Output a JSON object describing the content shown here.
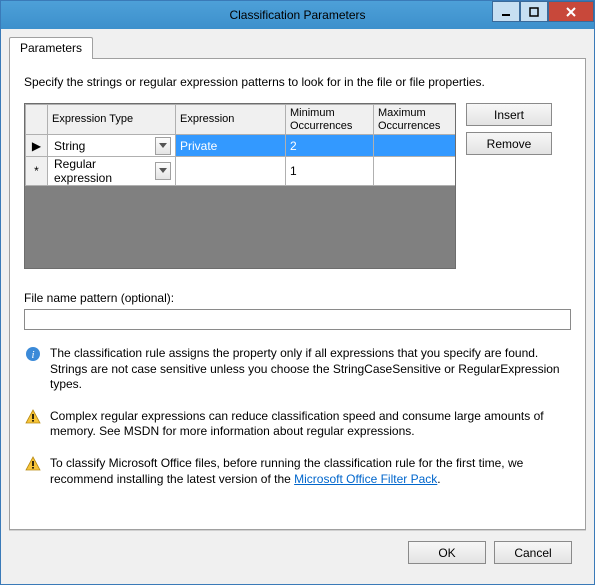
{
  "window": {
    "title": "Classification Parameters"
  },
  "tabs": {
    "parameters": "Parameters"
  },
  "instruction": "Specify the strings or regular expression patterns to look for in the file or file properties.",
  "grid": {
    "headers": {
      "expression_type": "Expression Type",
      "expression": "Expression",
      "min_occ": "Minimum Occurrences",
      "max_occ": "Maximum Occurrences"
    },
    "rows": [
      {
        "marker": "▶",
        "type": "String",
        "expression": "Private",
        "min": "2",
        "max": "",
        "selected": true
      },
      {
        "marker": "*",
        "type": "Regular expression",
        "expression": "",
        "min": "1",
        "max": "",
        "selected": false
      }
    ]
  },
  "buttons": {
    "insert": "Insert",
    "remove": "Remove",
    "ok": "OK",
    "cancel": "Cancel"
  },
  "filename_pattern": {
    "label": "File name pattern (optional):",
    "value": ""
  },
  "notes": {
    "info": "The classification rule assigns the property only if all expressions that you specify are found. Strings are not case sensitive unless you choose the StringCaseSensitive or RegularExpression types.",
    "warn1": "Complex regular expressions can reduce classification speed and consume large amounts of memory. See MSDN for more information about regular expressions.",
    "warn2_prefix": "To classify Microsoft Office files, before running the classification rule for the first time, we recommend installing the latest version of the ",
    "warn2_link": "Microsoft Office Filter Pack",
    "warn2_suffix": "."
  }
}
